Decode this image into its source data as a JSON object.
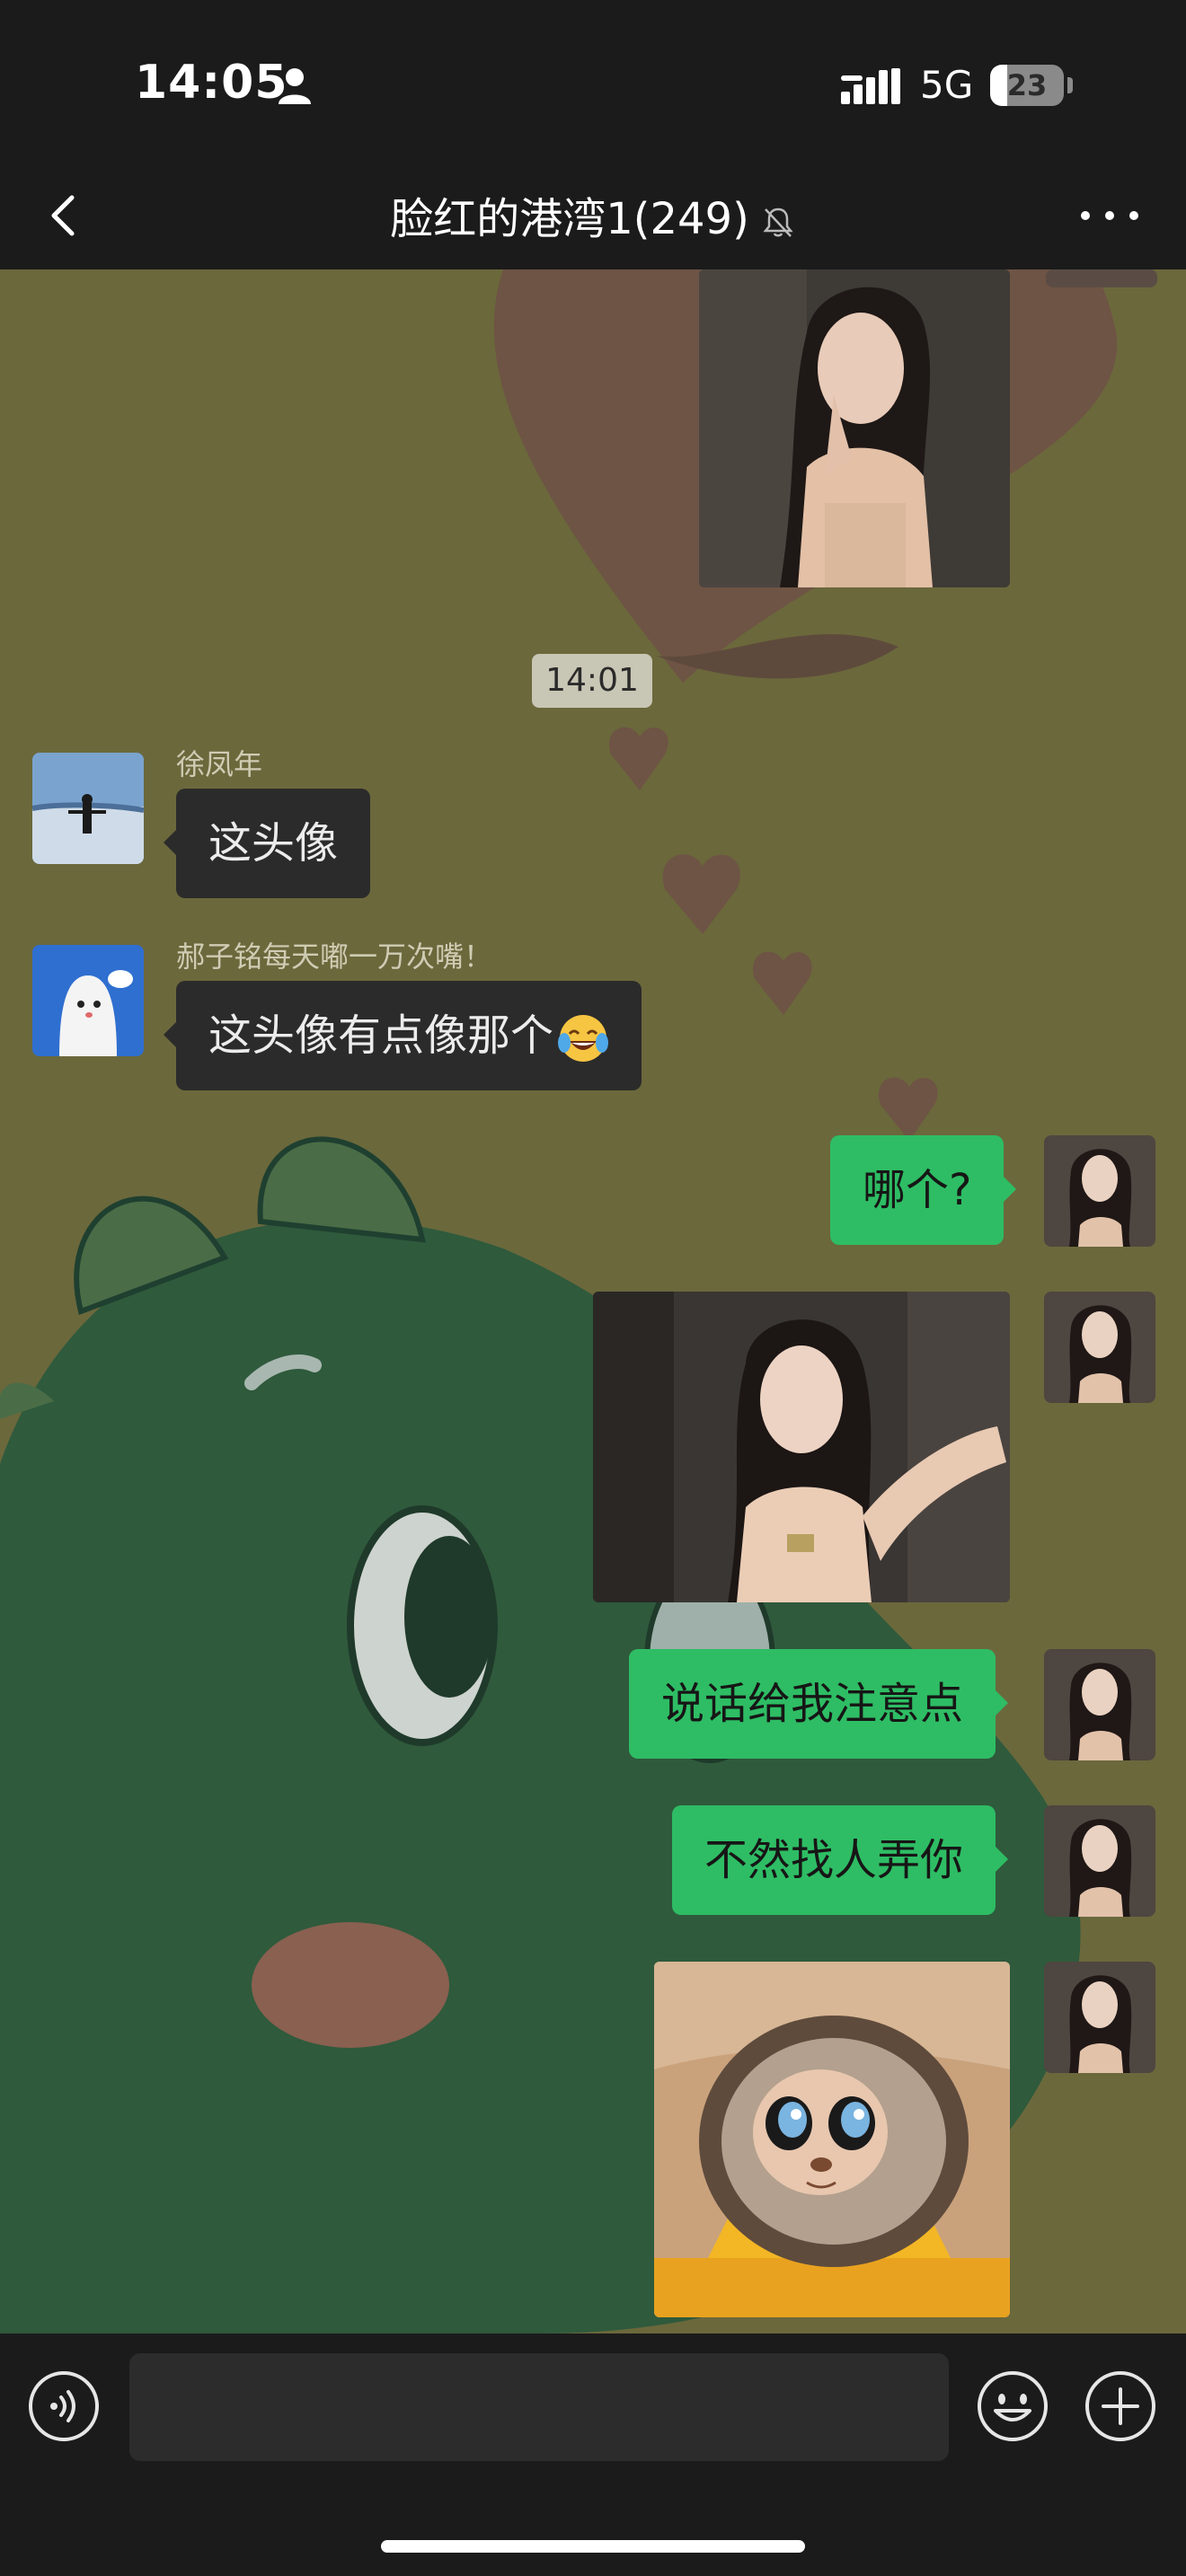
{
  "status_bar": {
    "time": "14:05",
    "network": "5G",
    "battery_level": "23",
    "battery_fraction": 0.23
  },
  "nav": {
    "title": "脸红的港湾1(249)",
    "muted": true,
    "back_icon": "chevron-left-icon",
    "more_icon": "ellipsis-icon"
  },
  "chat": {
    "timestamp": "14:01",
    "messages": [
      {
        "direction": "out",
        "type": "image",
        "content": "photo-girl-hand-on-chin"
      },
      {
        "direction": "in",
        "sender": "徐凤年",
        "type": "text",
        "text": "这头像"
      },
      {
        "direction": "in",
        "sender": "郝子铭每天嘟一万次嘴！",
        "type": "text",
        "text": "这头像有点像那个",
        "emoji": "face-with-tears-of-joy"
      },
      {
        "direction": "out",
        "type": "text",
        "text": "哪个?"
      },
      {
        "direction": "out",
        "type": "image",
        "content": "selfie-girl-peace-pose"
      },
      {
        "direction": "out",
        "type": "text",
        "text": "说话给我注意点"
      },
      {
        "direction": "out",
        "type": "text",
        "text": "不然找人弄你"
      },
      {
        "direction": "out",
        "type": "image",
        "content": "plush-doll-in-paper-bag"
      }
    ]
  },
  "input_bar": {
    "placeholder": "",
    "voice_icon": "voice-icon",
    "emoji_icon": "smiley-icon",
    "plus_icon": "plus-icon"
  },
  "colors": {
    "bar_bg": "#1b1b1b",
    "chat_bg": "#6b683c",
    "bubble_in": "#2b2b2b",
    "bubble_out": "#2ebd64",
    "text_light": "#ececec"
  }
}
